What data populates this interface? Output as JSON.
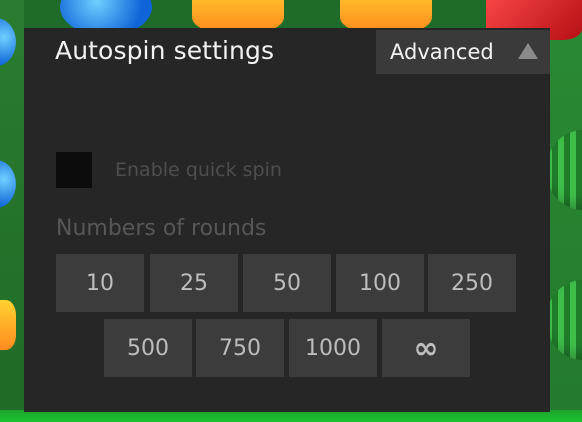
{
  "dialog": {
    "title": "Autospin settings",
    "advanced_label": "Advanced",
    "advanced_icon": "triangle-up-icon",
    "quick_spin": {
      "label": "Enable quick spin",
      "checked": false
    },
    "rounds_label": "Numbers of rounds",
    "round_options": [
      "10",
      "25",
      "50",
      "100",
      "250",
      "500",
      "750",
      "1000",
      "∞"
    ]
  },
  "colors": {
    "panel_bg": "#262626",
    "button_bg": "#3c3c3c",
    "title_text": "#f2f2f2",
    "disabled_text": "#4e4e4e",
    "board_green": "#1e6b2a"
  }
}
